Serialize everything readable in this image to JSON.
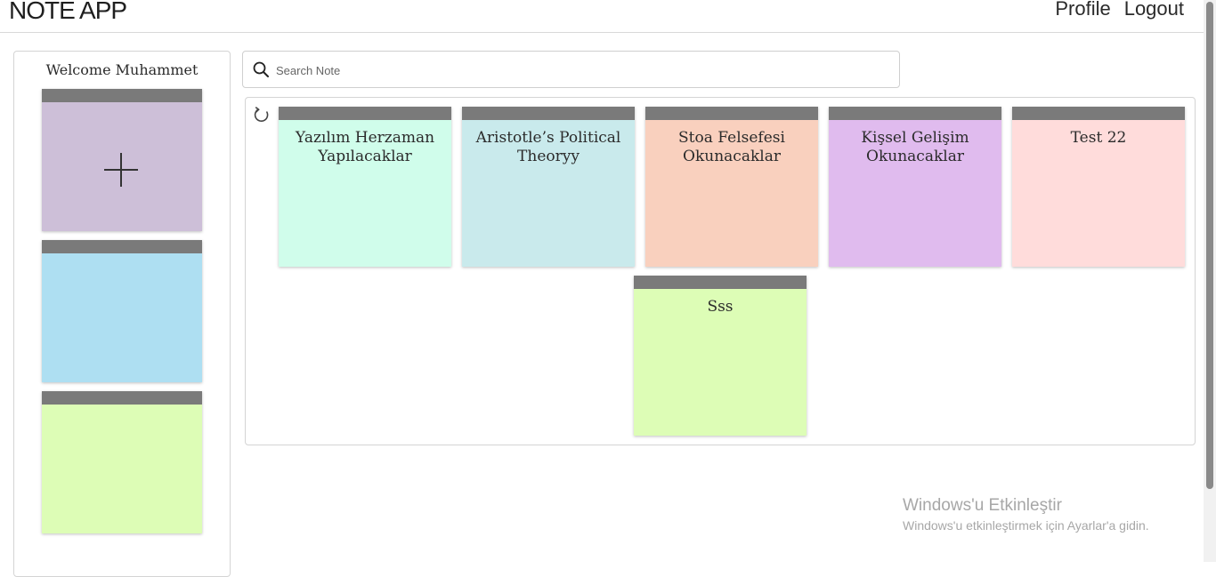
{
  "app": {
    "brand": "NOTE APP",
    "nav": {
      "profile": "Profile",
      "logout": "Logout"
    }
  },
  "sidebar": {
    "welcome": "Welcome Muhammet",
    "color_options": [
      {
        "name": "add-note",
        "color": "#cdbfd8",
        "icon": "plus-icon"
      },
      {
        "name": "blue",
        "color": "#aedff2"
      },
      {
        "name": "green",
        "color": "#ddfdb6"
      }
    ]
  },
  "search": {
    "placeholder": "Search Note",
    "value": ""
  },
  "notes": [
    {
      "title": "Yazılım Herzaman Yapılacaklar",
      "color": "#d0fdeb"
    },
    {
      "title": "Aristotle’s Political Theoryy",
      "color": "#c9eaec"
    },
    {
      "title": "Stoa Felsefesi Okunacaklar",
      "color": "#f9d0be"
    },
    {
      "title": "Kişsel Gelişim Okunacaklar",
      "color": "#e0bbee"
    },
    {
      "title": "Test 22",
      "color": "#ffdcdb"
    },
    {
      "title": "Sss",
      "color": "#ddfdb6"
    }
  ],
  "toolbar": {
    "refresh_icon": "refresh-icon"
  },
  "windows_watermark": {
    "title": "Windows'u Etkinleştir",
    "subtitle": "Windows'u etkinleştirmek için Ayarlar'a gidin."
  },
  "colors": {
    "note_header": "#7a7a7a"
  }
}
